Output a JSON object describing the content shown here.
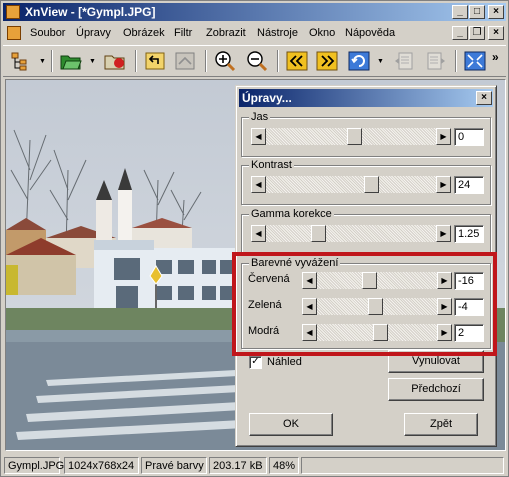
{
  "window": {
    "title": "XnView - [*Gympl.JPG]"
  },
  "menu": {
    "items": [
      "Soubor",
      "Úpravy",
      "Obrázek",
      "Filtr",
      "Zobrazit",
      "Nástroje",
      "Okno",
      "Nápověda"
    ]
  },
  "toolbar": {
    "tools": [
      "browser-icon",
      "open-icon",
      "save-icon",
      "undo-icon",
      "redo-icon",
      "zoom-in-icon",
      "zoom-out-icon",
      "previous-icon",
      "next-icon",
      "refresh-icon",
      "fullscreen-icon"
    ]
  },
  "statusbar": {
    "filename": "Gympl.JPG",
    "dimensions": "1024x768x24",
    "color_mode": "Pravé barvy",
    "filesize": "203.17 kB",
    "zoom": "48%"
  },
  "dialog": {
    "title": "Úpravy...",
    "brightness": {
      "label": "Jas",
      "value": "0"
    },
    "contrast": {
      "label": "Kontrast",
      "value": "24"
    },
    "gamma": {
      "label": "Gamma korekce",
      "value": "1.25"
    },
    "color_balance": {
      "label": "Barevné vyvážení",
      "red": {
        "label": "Červená",
        "value": "-16"
      },
      "green": {
        "label": "Zelená",
        "value": "-4"
      },
      "blue": {
        "label": "Modrá",
        "value": "2"
      }
    },
    "preview": {
      "label": "Náhled",
      "checked": true
    },
    "reset_button": "Vynulovat",
    "previous_button": "Předchozí",
    "ok_button": "OK",
    "back_button": "Zpět"
  }
}
